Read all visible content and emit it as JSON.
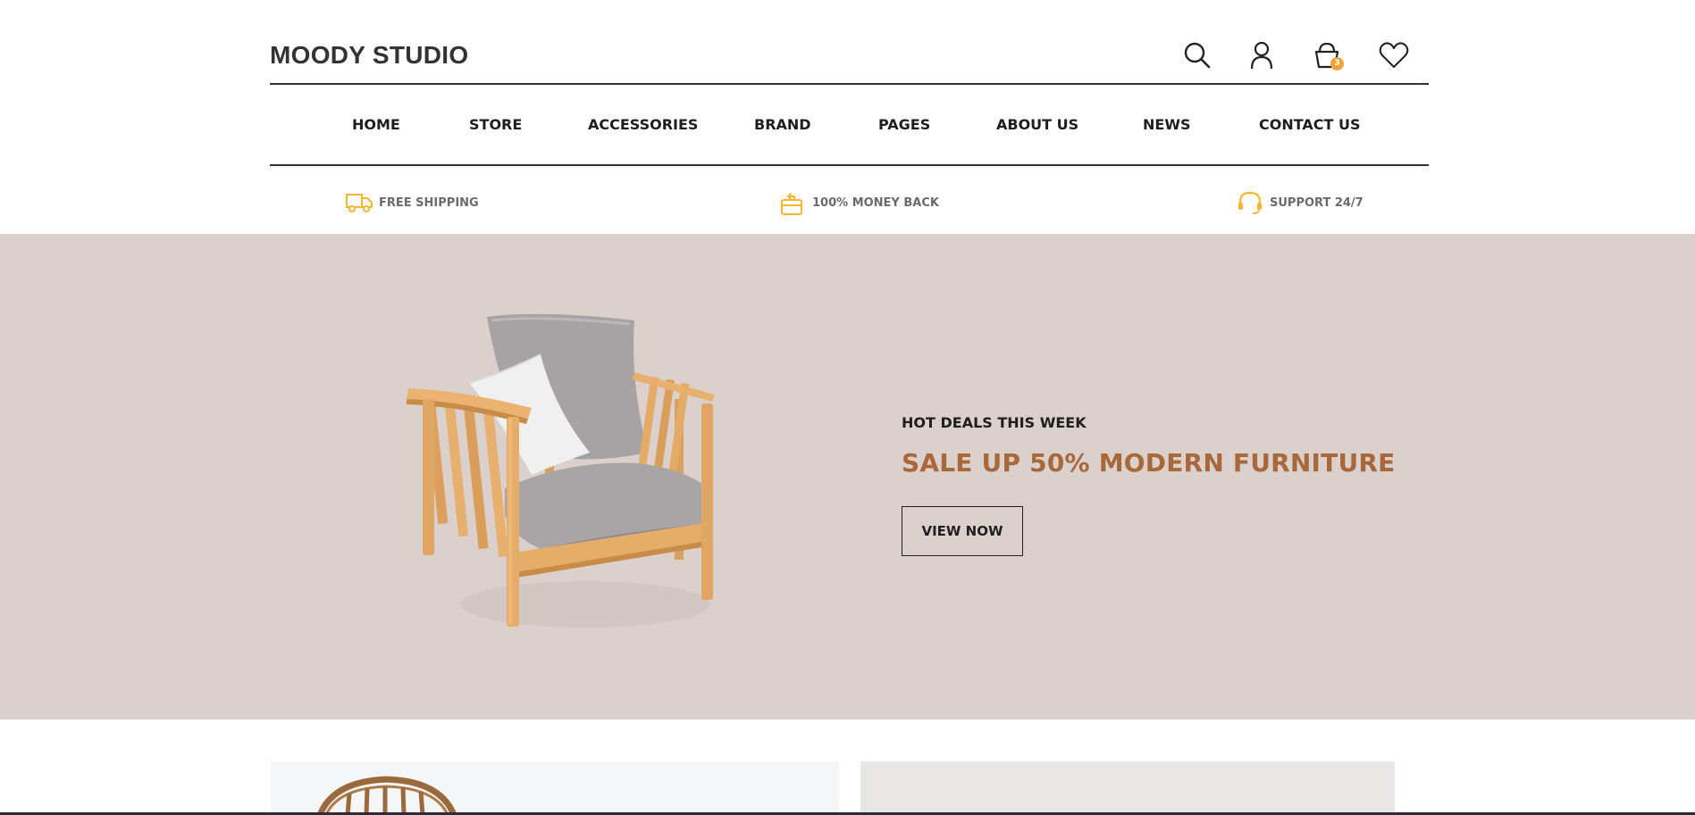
{
  "header": {
    "logo": "MOODY STUDIO",
    "icons": [
      "search-icon",
      "user-icon",
      "cart-icon",
      "heart-icon"
    ],
    "cart_count": "3"
  },
  "nav": {
    "items": [
      {
        "label": "HOME"
      },
      {
        "label": "STORE"
      },
      {
        "label": "ACCESSORIES"
      },
      {
        "label": "BRAND"
      },
      {
        "label": "PAGES"
      },
      {
        "label": "ABOUT US"
      },
      {
        "label": "NEWS"
      },
      {
        "label": "CONTACT US"
      }
    ]
  },
  "features": {
    "items": [
      {
        "label": "FREE SHIPPING",
        "icon": "truck-icon"
      },
      {
        "label": "100% MONEY BACK",
        "icon": "money-back-icon"
      },
      {
        "label": "SUPPORT 24/7",
        "icon": "headset-icon"
      }
    ]
  },
  "hero": {
    "subtitle": "HOT DEALS THIS WEEK",
    "title": "SALE UP 50% MODERN FURNITURE",
    "button": "VIEW NOW",
    "image": "wooden-armchair"
  },
  "colors": {
    "accent": "#a9683a",
    "icon_yellow": "#f5b730",
    "hero_bg": "#dbd0cc",
    "badge": "#f0a23b"
  }
}
